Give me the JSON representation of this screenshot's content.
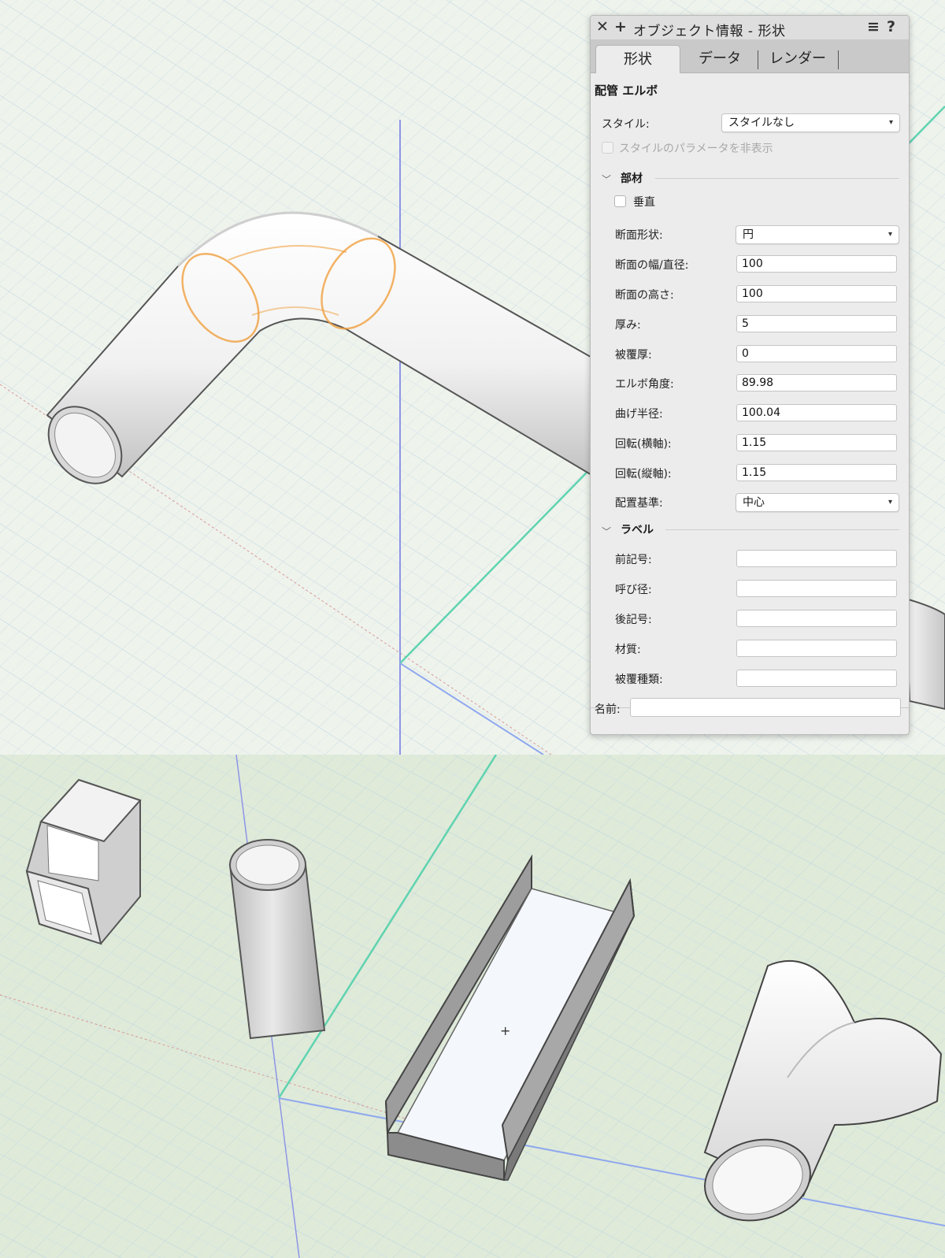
{
  "palette": {
    "title": "オブジェクト情報 - 形状",
    "tabs": [
      {
        "label": "形状",
        "active": true
      },
      {
        "label": "データ",
        "active": false
      },
      {
        "label": "レンダー",
        "active": false
      }
    ],
    "object_type": "配管 エルボ",
    "style_label": "スタイル:",
    "style_value": "スタイルなし",
    "hide_style_params_label": "スタイルのパラメータを非表示",
    "sections": {
      "member": {
        "title": "部材",
        "vertical_label": "垂直",
        "section_shape_label": "断面形状:",
        "section_shape_value": "円",
        "fields": [
          {
            "label": "断面の幅/直径:",
            "value": "100"
          },
          {
            "label": "断面の高さ:",
            "value": "100"
          },
          {
            "label": "厚み:",
            "value": "5"
          },
          {
            "label": "被覆厚:",
            "value": "0"
          },
          {
            "label": "エルボ角度:",
            "value": "89.98"
          },
          {
            "label": "曲げ半径:",
            "value": "100.04"
          },
          {
            "label": "回転(横軸):",
            "value": "1.15"
          },
          {
            "label": "回転(縦軸):",
            "value": "1.15"
          }
        ],
        "placement_label": "配置基準:",
        "placement_value": "中心"
      },
      "label": {
        "title": "ラベル",
        "fields": [
          {
            "label": "前記号:",
            "value": ""
          },
          {
            "label": "呼び径:",
            "value": ""
          },
          {
            "label": "後記号:",
            "value": ""
          },
          {
            "label": "材質:",
            "value": ""
          },
          {
            "label": "被覆種類:",
            "value": ""
          }
        ]
      }
    },
    "name_label": "名前:",
    "name_value": ""
  },
  "icons": {
    "close": "close-icon",
    "pin": "plus-icon",
    "menu": "menu-icon",
    "help": "help-icon"
  },
  "colors": {
    "palette_bg": "#ececec",
    "tab_bar_bg": "#c9c9c9",
    "selection_orange": "#f0a040",
    "axis_blue": "#8e95e8",
    "axis_green": "#5fd3b0",
    "grid": "#c8dbe6"
  }
}
